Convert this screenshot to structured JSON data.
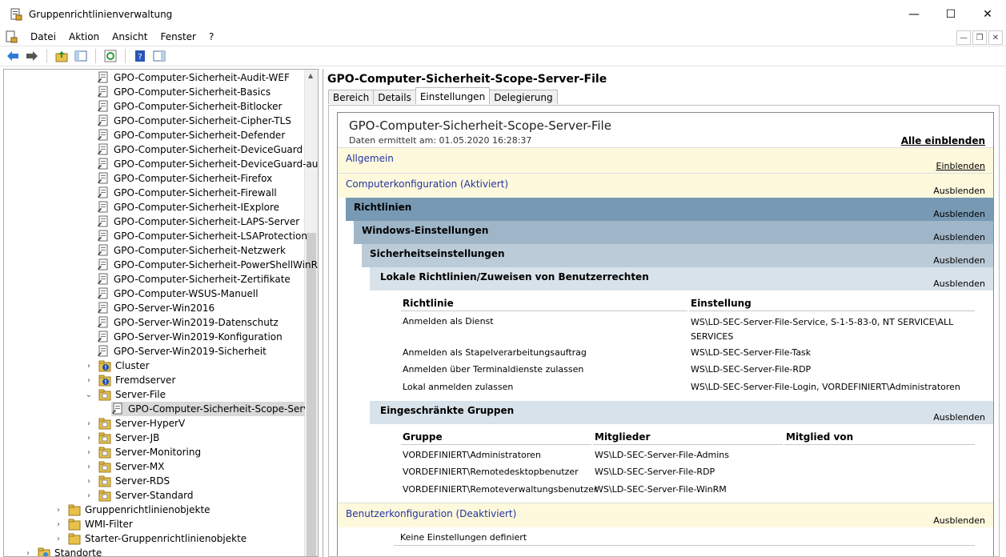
{
  "window": {
    "title": "Gruppenrichtlinienverwaltung",
    "minimize": "—",
    "maximize": "☐",
    "close": "✕"
  },
  "menu": [
    "Datei",
    "Aktion",
    "Ansicht",
    "Fenster",
    "?"
  ],
  "mdi": {
    "min": "—",
    "restore": "❐",
    "close": "✕"
  },
  "tree": {
    "gpos": [
      "GPO-Computer-Sicherheit-Audit-WEF",
      "GPO-Computer-Sicherheit-Basics",
      "GPO-Computer-Sicherheit-Bitlocker",
      "GPO-Computer-Sicherheit-Cipher-TLS",
      "GPO-Computer-Sicherheit-Defender",
      "GPO-Computer-Sicherheit-DeviceGuard",
      "GPO-Computer-Sicherheit-DeviceGuard-aus",
      "GPO-Computer-Sicherheit-Firefox",
      "GPO-Computer-Sicherheit-Firewall",
      "GPO-Computer-Sicherheit-IExplore",
      "GPO-Computer-Sicherheit-LAPS-Server",
      "GPO-Computer-Sicherheit-LSAProtection",
      "GPO-Computer-Sicherheit-Netzwerk",
      "GPO-Computer-Sicherheit-PowerShellWinRM",
      "GPO-Computer-Sicherheit-Zertifikate",
      "GPO-Computer-WSUS-Manuell",
      "GPO-Server-Win2016",
      "GPO-Server-Win2019-Datenschutz",
      "GPO-Server-Win2019-Konfiguration",
      "GPO-Server-Win2019-Sicherheit"
    ],
    "cluster": "Cluster",
    "fremdserver": "Fremdserver",
    "server_file": "Server-File",
    "selected_gpo": "GPO-Computer-Sicherheit-Scope-Server-File",
    "ous": [
      "Server-HyperV",
      "Server-JB",
      "Server-Monitoring",
      "Server-MX",
      "Server-RDS",
      "Server-Standard"
    ],
    "top": [
      "Gruppenrichtlinienobjekte",
      "WMI-Filter",
      "Starter-Gruppenrichtlinienobjekte"
    ],
    "standorte": "Standorte"
  },
  "right": {
    "title": "GPO-Computer-Sicherheit-Scope-Server-File",
    "tabs": [
      "Bereich",
      "Details",
      "Einstellungen",
      "Delegierung"
    ],
    "report": {
      "title": "GPO-Computer-Sicherheit-Scope-Server-File",
      "date": "Daten ermittelt am: 01.05.2020 16:28:37",
      "show_all": "Alle einblenden",
      "allgemein": "Allgemein",
      "einblenden": "Einblenden",
      "computerkonfig": "Computerkonfiguration (Aktiviert)",
      "ausblenden": "Ausblenden",
      "richtlinien": "Richtlinien",
      "windows_einst": "Windows-Einstellungen",
      "sicherheit": "Sicherheitseinstellungen",
      "lokale": "Lokale Richtlinien/Zuweisen von Benutzerrechten",
      "col_richtlinie": "Richtlinie",
      "col_einstellung": "Einstellung",
      "rights": [
        {
          "name": "Anmelden als Dienst",
          "value1": "WS\\LD-SEC-Server-File-Service, S-1-5-83-0, NT SERVICE\\ALL",
          "value2": "SERVICES"
        },
        {
          "name": "Anmelden als Stapelverarbeitungsauftrag",
          "value1": "WS\\LD-SEC-Server-File-Task",
          "value2": ""
        },
        {
          "name": "Anmelden über Terminaldienste zulassen",
          "value1": "WS\\LD-SEC-Server-File-RDP",
          "value2": ""
        },
        {
          "name": "Lokal anmelden zulassen",
          "value1": "WS\\LD-SEC-Server-File-Login, VORDEFINIERT\\Administratoren",
          "value2": ""
        }
      ],
      "eingeschraenkt": "Eingeschränkte Gruppen",
      "col_gruppe": "Gruppe",
      "col_mitglieder": "Mitglieder",
      "col_mitglied_von": "Mitglied von",
      "groups": [
        {
          "group": "VORDEFINIERT\\Administratoren",
          "members": "WS\\LD-SEC-Server-File-Admins"
        },
        {
          "group": "VORDEFINIERT\\Remotedesktopbenutzer",
          "members": "WS\\LD-SEC-Server-File-RDP"
        },
        {
          "group": "VORDEFINIERT\\Remoteverwaltungsbenutzer",
          "members": "WS\\LD-SEC-Server-File-WinRM"
        }
      ],
      "benutzerkonfig": "Benutzerkonfiguration (Deaktiviert)",
      "keine": "Keine Einstellungen definiert"
    }
  },
  "colors": {
    "section_bg": "#fef9dd",
    "section_text": "#2233a0",
    "bar1": "#7899b3",
    "bar2": "#9fb6c9",
    "bar3": "#bccbd8",
    "bar4": "#d8e2ea"
  }
}
